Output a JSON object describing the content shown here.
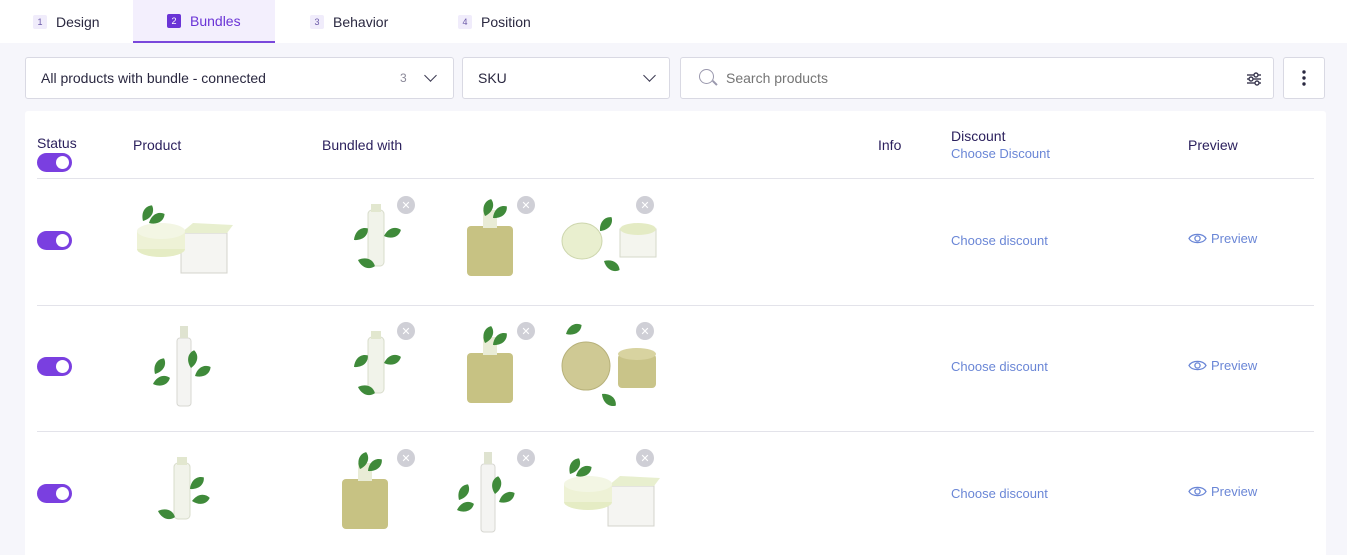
{
  "tabs": [
    {
      "num": "1",
      "label": "Design"
    },
    {
      "num": "2",
      "label": "Bundles"
    },
    {
      "num": "3",
      "label": "Behavior"
    },
    {
      "num": "4",
      "label": "Position"
    }
  ],
  "filters": {
    "bundle_select": {
      "value": "All products with bundle - connected",
      "count": "3"
    },
    "sku_select": {
      "value": "SKU"
    },
    "search": {
      "placeholder": "Search products"
    }
  },
  "table": {
    "headers": {
      "status": "Status",
      "product": "Product",
      "bundled_with": "Bundled with",
      "info": "Info",
      "discount": "Discount",
      "discount_link": "Choose Discount",
      "preview": "Preview"
    },
    "rows": [
      {
        "status_on": true,
        "product_icon": "cream-box-product-image",
        "bundled": [
          "serum-bottle-image",
          "gold-jar-image",
          "cream-jar-image"
        ],
        "discount_link": "Choose discount",
        "preview_label": "Preview"
      },
      {
        "status_on": true,
        "product_icon": "spray-bottle-leaf-image",
        "bundled": [
          "serum-bottle-image",
          "gold-jar-image",
          "gold-cream-jar-image"
        ],
        "discount_link": "Choose discount",
        "preview_label": "Preview"
      },
      {
        "status_on": true,
        "product_icon": "serum-bottle-image",
        "bundled": [
          "gold-jar-image",
          "spray-bottle-leaf-image",
          "cream-box-product-image"
        ],
        "discount_link": "Choose discount",
        "preview_label": "Preview"
      }
    ]
  },
  "colors": {
    "accent": "#7a3fe0",
    "link": "#6a86d6",
    "header_text": "#2a1f5c"
  }
}
